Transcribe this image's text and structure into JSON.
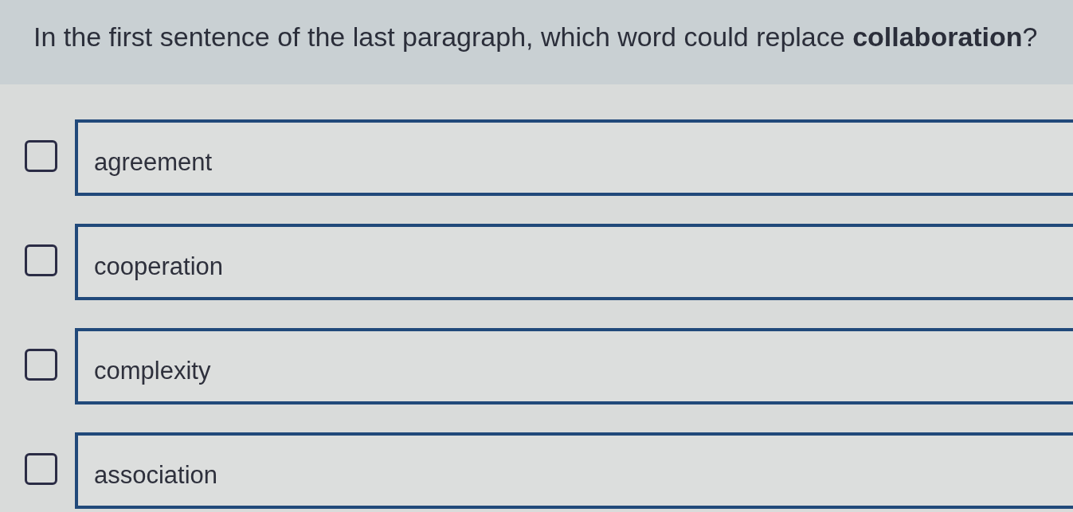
{
  "question": "In the first sentence of the last paragraph, which word could replace **collaboration**?",
  "options": [
    {
      "label": "agreement",
      "checked": false
    },
    {
      "label": "cooperation",
      "checked": false
    },
    {
      "label": "complexity",
      "checked": false
    },
    {
      "label": "association",
      "checked": false
    }
  ]
}
